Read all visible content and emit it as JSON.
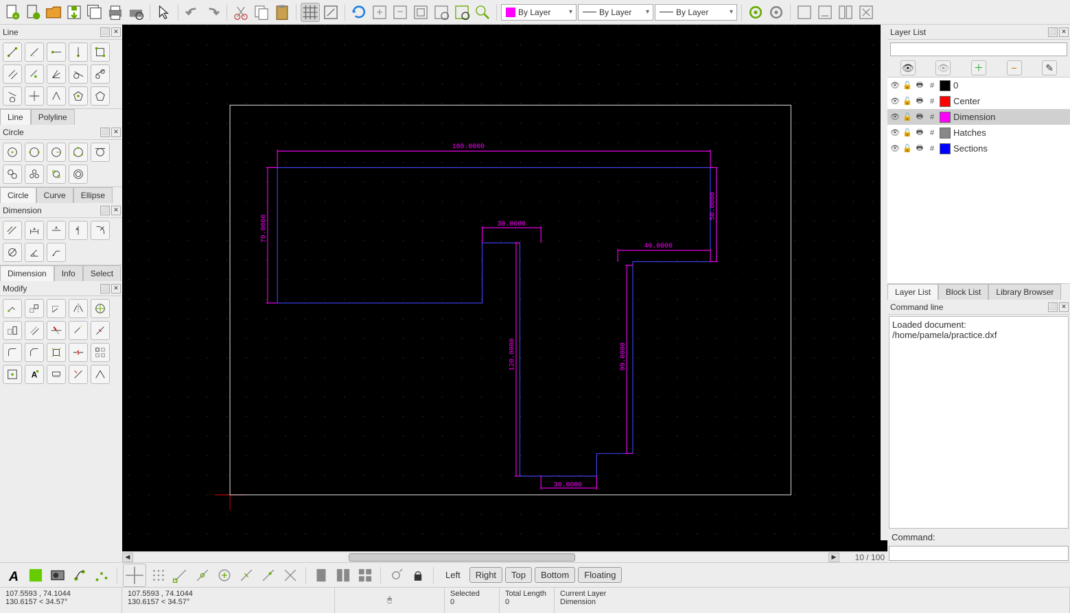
{
  "main_toolbar": {
    "color_bylayer": "By Layer",
    "width_bylayer": "By Layer",
    "linetype_bylayer": "By Layer"
  },
  "left": {
    "panels": {
      "line": {
        "title": "Line",
        "tabs": [
          "Line",
          "Polyline"
        ],
        "active_tab": 0
      },
      "circle": {
        "title": "Circle",
        "tabs": [
          "Circle",
          "Curve",
          "Ellipse"
        ],
        "active_tab": 0
      },
      "dimension": {
        "title": "Dimension",
        "tabs": [
          "Dimension",
          "Info",
          "Select"
        ],
        "active_tab": 0
      },
      "modify": {
        "title": "Modify"
      }
    }
  },
  "right": {
    "layer_list_title": "Layer List",
    "layers": [
      {
        "name": "0",
        "color": "#000000"
      },
      {
        "name": "Center",
        "color": "#ff0000"
      },
      {
        "name": "Dimension",
        "color": "#ff00ff",
        "selected": true
      },
      {
        "name": "Hatches",
        "color": "#888888"
      },
      {
        "name": "Sections",
        "color": "#0000ff"
      }
    ],
    "tabs": [
      "Layer List",
      "Block List",
      "Library Browser"
    ],
    "active_tab": 0,
    "cmd_title": "Command line",
    "cmd_log_lines": [
      "Loaded document:",
      "/home/pamela/practice.dxf"
    ],
    "cmd_prompt": "Command:"
  },
  "canvas": {
    "zoom_label": "10 / 100",
    "dims": {
      "top": "160.0000",
      "left": "70.0000",
      "upper_mid": "30.0000",
      "right_top": "50.0000",
      "right_mid": "40.0000",
      "mid_vert": "120.0000",
      "right_vert": "99.0000",
      "bottom": "30.0000"
    }
  },
  "dock": {
    "buttons": [
      "Left",
      "Right",
      "Top",
      "Bottom",
      "Floating"
    ]
  },
  "status": {
    "abs_coord": "107.5593 , 74.1044",
    "rel_coord": "130.6157 < 34.57°",
    "abs_coord2": "107.5593 , 74.1044",
    "rel_coord2": "130.6157 < 34.57°",
    "selected_label": "Selected",
    "selected_val": "0",
    "length_label": "Total Length",
    "length_val": "0",
    "curlayer_label": "Current Layer",
    "curlayer_val": "Dimension"
  }
}
